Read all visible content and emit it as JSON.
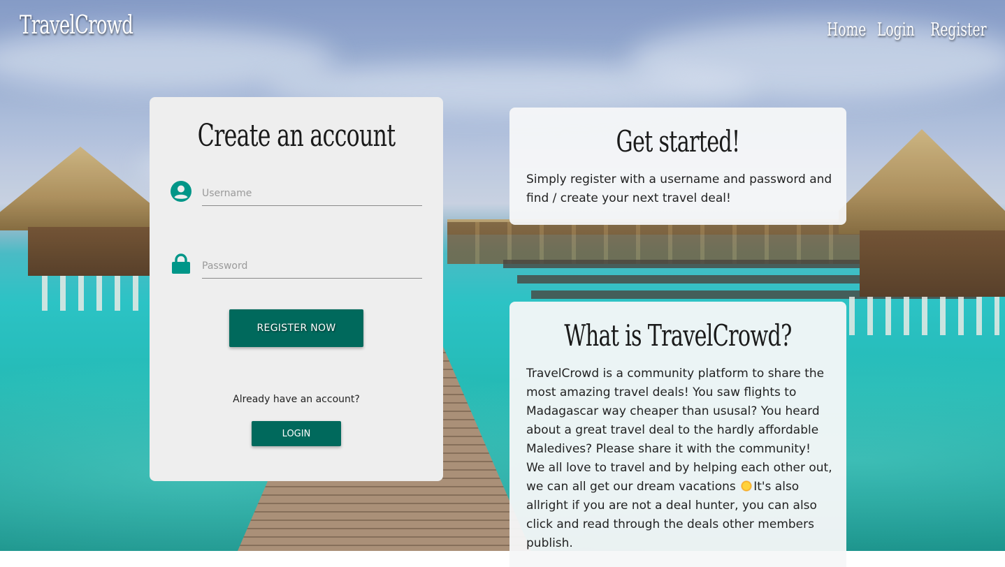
{
  "nav": {
    "brand": "TravelCrowd",
    "links": [
      {
        "label": "Home"
      },
      {
        "label": "Login"
      },
      {
        "label": "Register"
      }
    ]
  },
  "register_card": {
    "title": "Create an account",
    "username": {
      "placeholder": "Username",
      "icon": "account-circle-icon"
    },
    "password": {
      "placeholder": "Password",
      "icon": "lock-icon"
    },
    "submit_label": "REGISTER NOW",
    "already_text": "Already have an account?",
    "login_label": "LOGIN"
  },
  "get_started": {
    "title": "Get started!",
    "text": "Simply register with a username and password and find / create your next travel deal!"
  },
  "what_is": {
    "title": "What is TravelCrowd?",
    "text_before_emoji": "TravelCrowd is a community platform to share the most amazing travel deals! You saw flights to Madagascar way cheaper than ususal? You heard about a great travel deal to the hardly affordable Maledives? Please share it with the community! We all love to travel and by helping each other out, we can all get our dream vacations",
    "emoji": "sun-icon",
    "text_after_emoji": "It's also allright if you are not a deal hunter, you can also click and read through the deals other members publish."
  },
  "colors": {
    "accent": "#00695c",
    "icon_teal": "#009688",
    "card_bg": "#eeeeee"
  },
  "background": "tropical-jetty-photo"
}
